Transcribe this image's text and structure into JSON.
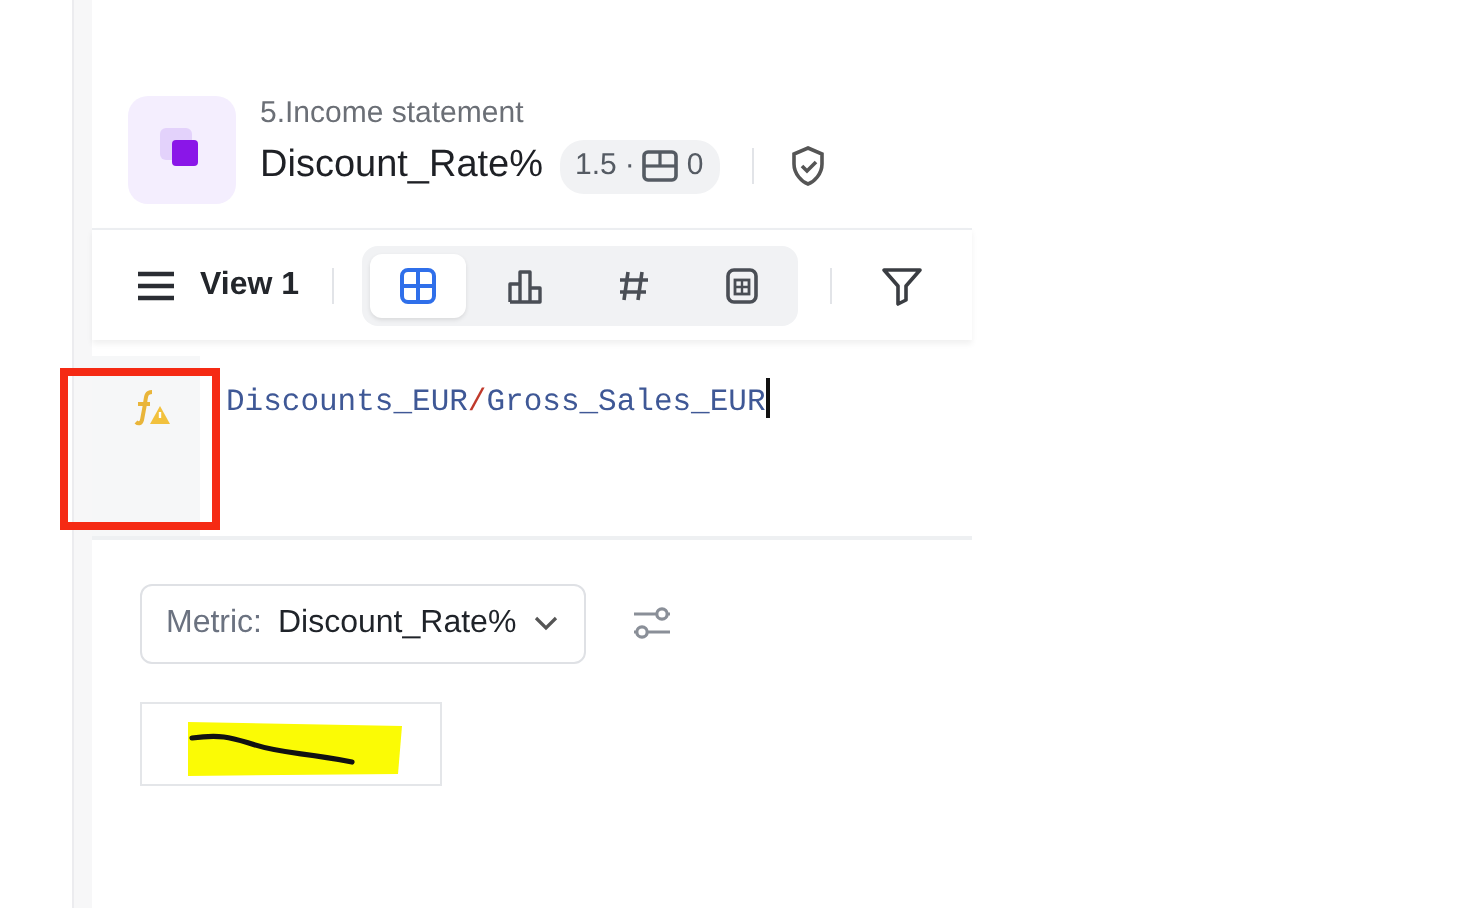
{
  "header": {
    "subtitle": "5.Income statement",
    "title": "Discount_Rate%",
    "version": "1.5",
    "sep": "·",
    "count": "0"
  },
  "toolbar": {
    "view_label": "View 1",
    "view_modes": [
      {
        "kind": "grid",
        "selected": true
      },
      {
        "kind": "chart",
        "selected": false
      },
      {
        "kind": "number",
        "selected": false
      },
      {
        "kind": "card",
        "selected": false
      }
    ]
  },
  "formula": {
    "tokens": [
      {
        "text": "Discounts_EUR",
        "kind": "field"
      },
      {
        "text": "/",
        "kind": "operator"
      },
      {
        "text": "Gross_Sales_EUR",
        "kind": "field"
      }
    ]
  },
  "metric": {
    "label": "Metric:",
    "value": "Discount_Rate%"
  }
}
